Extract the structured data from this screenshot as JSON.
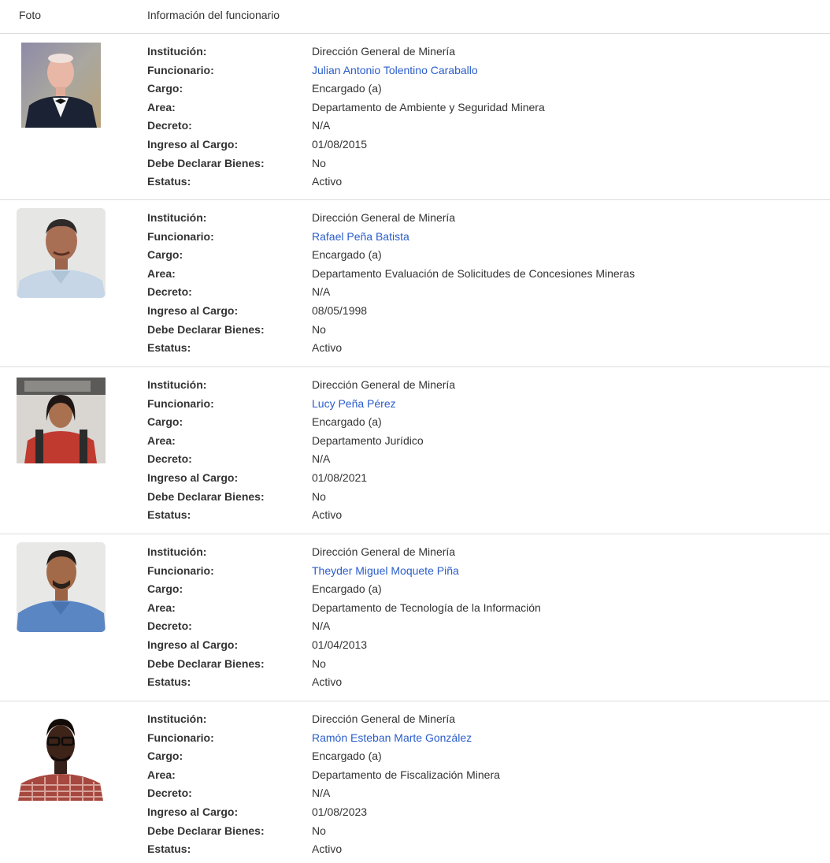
{
  "header": {
    "photo_col": "Foto",
    "info_col": "Información del funcionario"
  },
  "labels": {
    "institucion": "Institución:",
    "funcionario": "Funcionario:",
    "cargo": "Cargo:",
    "area": "Area:",
    "decreto": "Decreto:",
    "ingreso": "Ingreso al Cargo:",
    "declarar": "Debe Declarar Bienes:",
    "estatus": "Estatus:"
  },
  "records": [
    {
      "institucion": "Dirección General de Minería",
      "funcionario": "Julian Antonio Tolentino Caraballo",
      "cargo": "Encargado (a)",
      "area": "Departamento de Ambiente y Seguridad Minera",
      "decreto": "N/A",
      "ingreso": "01/08/2015",
      "declarar": "No",
      "estatus": "Activo"
    },
    {
      "institucion": "Dirección General de Minería",
      "funcionario": "Rafael Peña Batista",
      "cargo": "Encargado (a)",
      "area": "Departamento Evaluación de Solicitudes de Concesiones Mineras",
      "decreto": "N/A",
      "ingreso": "08/05/1998",
      "declarar": "No",
      "estatus": "Activo"
    },
    {
      "institucion": "Dirección General de Minería",
      "funcionario": "Lucy Peña Pérez",
      "cargo": "Encargado (a)",
      "area": "Departamento Jurídico",
      "decreto": "N/A",
      "ingreso": "01/08/2021",
      "declarar": "No",
      "estatus": "Activo"
    },
    {
      "institucion": "Dirección General de Minería",
      "funcionario": "Theyder Miguel Moquete Piña",
      "cargo": "Encargado (a)",
      "area": "Departamento de Tecnología de la Información",
      "decreto": "N/A",
      "ingreso": "01/04/2013",
      "declarar": "No",
      "estatus": "Activo"
    },
    {
      "institucion": "Dirección General de Minería",
      "funcionario": "Ramón Esteban Marte González",
      "cargo": "Encargado (a)",
      "area": "Departamento de Fiscalización Minera",
      "decreto": "N/A",
      "ingreso": "01/08/2023",
      "declarar": "No",
      "estatus": "Activo"
    }
  ],
  "colors": {
    "link": "#2a5dcb",
    "text": "#333333",
    "divider": "#dddddd"
  }
}
